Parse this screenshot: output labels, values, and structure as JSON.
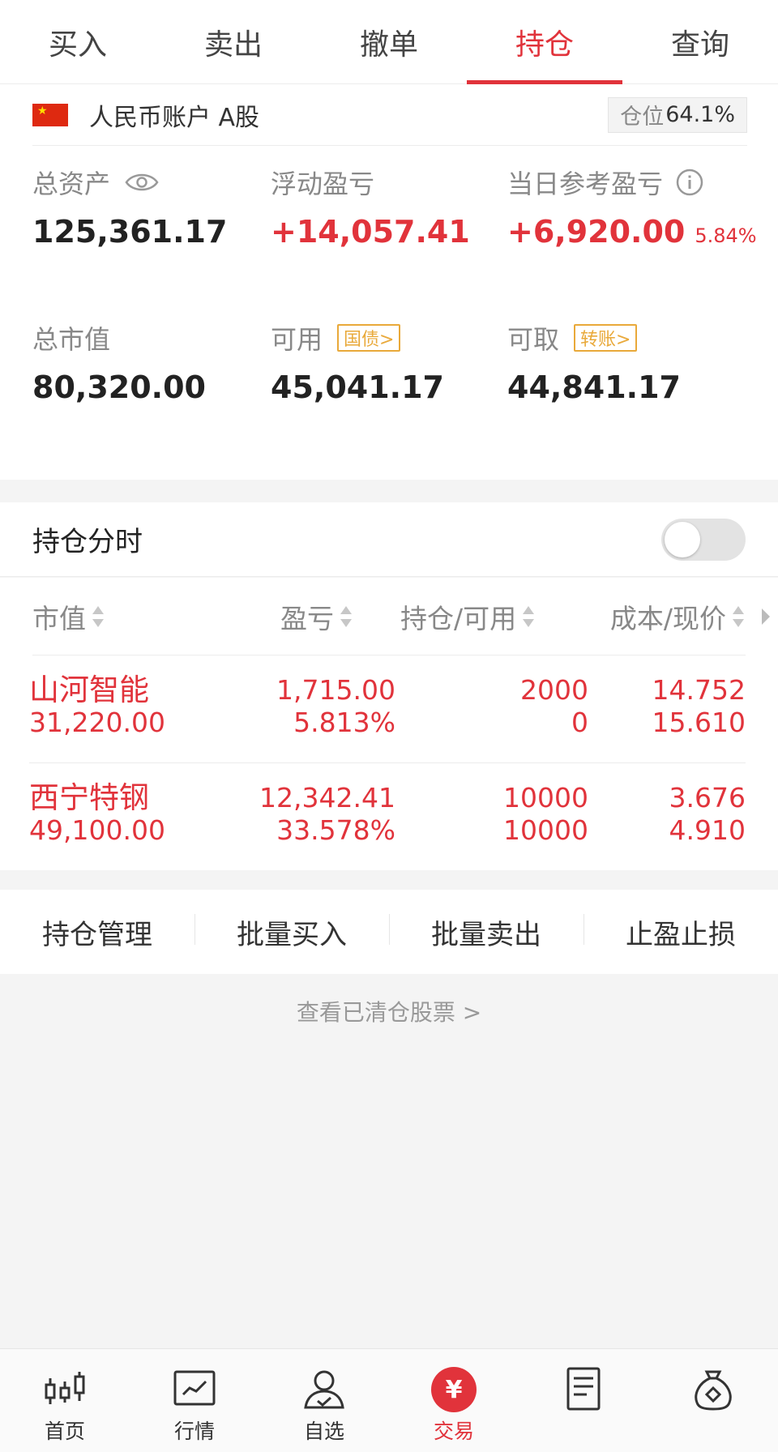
{
  "top_tabs": [
    {
      "label": "买入"
    },
    {
      "label": "卖出"
    },
    {
      "label": "撤单"
    },
    {
      "label": "持仓",
      "active": true
    },
    {
      "label": "查询"
    }
  ],
  "account": {
    "flag_icon": "china-flag-icon",
    "name": "人民币账户 A股",
    "position_label": "仓位",
    "position_value": "64.1%"
  },
  "metrics": {
    "total_assets": {
      "label": "总资产",
      "value": "125,361.17"
    },
    "floating_pnl": {
      "label": "浮动盈亏",
      "value": "+14,057.41"
    },
    "daily_pnl": {
      "label": "当日参考盈亏",
      "value": "+6,920.00",
      "percent": "5.84%"
    },
    "market_value": {
      "label": "总市值",
      "value": "80,320.00"
    },
    "available": {
      "label": "可用",
      "value": "45,041.17",
      "tag": "国债>"
    },
    "withdrawable": {
      "label": "可取",
      "value": "44,841.17",
      "tag": "转账>"
    }
  },
  "holding_time": {
    "title": "持仓分时",
    "toggle_on": false
  },
  "table": {
    "headers": [
      "市值",
      "盈亏",
      "持仓/可用",
      "成本/现价"
    ],
    "rows": [
      {
        "name": "山河智能",
        "market_value": "31,220.00",
        "pnl": "1,715.00",
        "pnl_pct": "5.813%",
        "holding": "2000",
        "available": "0",
        "cost": "14.752",
        "price": "15.610"
      },
      {
        "name": "西宁特钢",
        "market_value": "49,100.00",
        "pnl": "12,342.41",
        "pnl_pct": "33.578%",
        "holding": "10000",
        "available": "10000",
        "cost": "3.676",
        "price": "4.910"
      }
    ]
  },
  "actions": [
    "持仓管理",
    "批量买入",
    "批量卖出",
    "止盈止损"
  ],
  "cleared_link": "查看已清仓股票 >",
  "bottom_nav": [
    {
      "label": "首页",
      "icon": "candlestick-icon"
    },
    {
      "label": "行情",
      "icon": "line-chart-icon"
    },
    {
      "label": "自选",
      "icon": "user-check-icon"
    },
    {
      "label": "交易",
      "icon": "yuan-icon",
      "active": true
    },
    {
      "label": "",
      "icon": "document-icon"
    },
    {
      "label": "",
      "icon": "money-bag-icon"
    }
  ],
  "colors": {
    "accent": "#e1333b",
    "tag": "#e9a93a",
    "muted": "#888888"
  }
}
